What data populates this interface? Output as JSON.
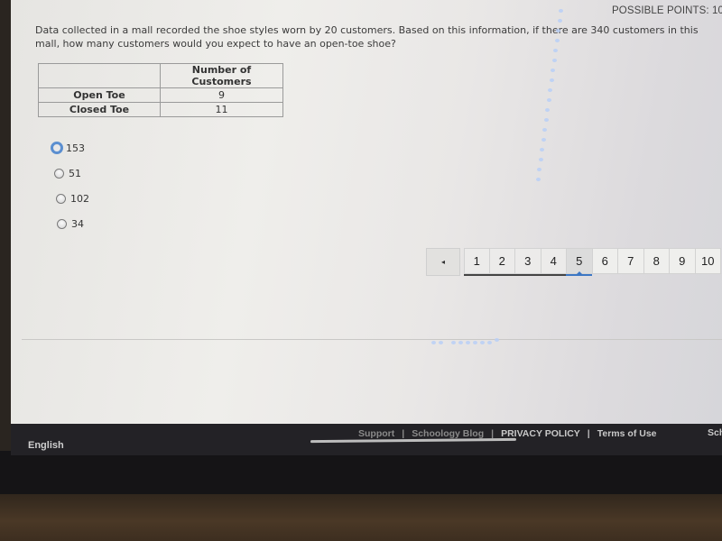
{
  "question": {
    "possible_points_label": "POSSIBLE POINTS: 10",
    "text": "Data collected in a mall recorded the shoe styles worn by 20 customers. Based on this information, if there are 340 customers in this mall, how many customers would you expect to have an open-toe shoe?",
    "table": {
      "headers": [
        "",
        "Number of Customers"
      ],
      "rows": [
        {
          "label": "Open Toe",
          "value": "9"
        },
        {
          "label": "Closed Toe",
          "value": "11"
        }
      ]
    },
    "choices": [
      {
        "label": "153",
        "focused": true
      },
      {
        "label": "51",
        "focused": false
      },
      {
        "label": "102",
        "focused": false
      },
      {
        "label": "34",
        "focused": false
      }
    ]
  },
  "pager": {
    "prev_icon": "◂",
    "pages": [
      "1",
      "2",
      "3",
      "4",
      "5",
      "6",
      "7",
      "8",
      "9",
      "10"
    ],
    "current_page": "5",
    "visited_pages": [
      "1",
      "2",
      "3",
      "4"
    ]
  },
  "footer": {
    "language": "English",
    "links": [
      "Support",
      "Schoology Blog",
      "PRIVACY POLICY",
      "Terms of Use"
    ],
    "separator": "|",
    "right_truncated": "Sch"
  }
}
